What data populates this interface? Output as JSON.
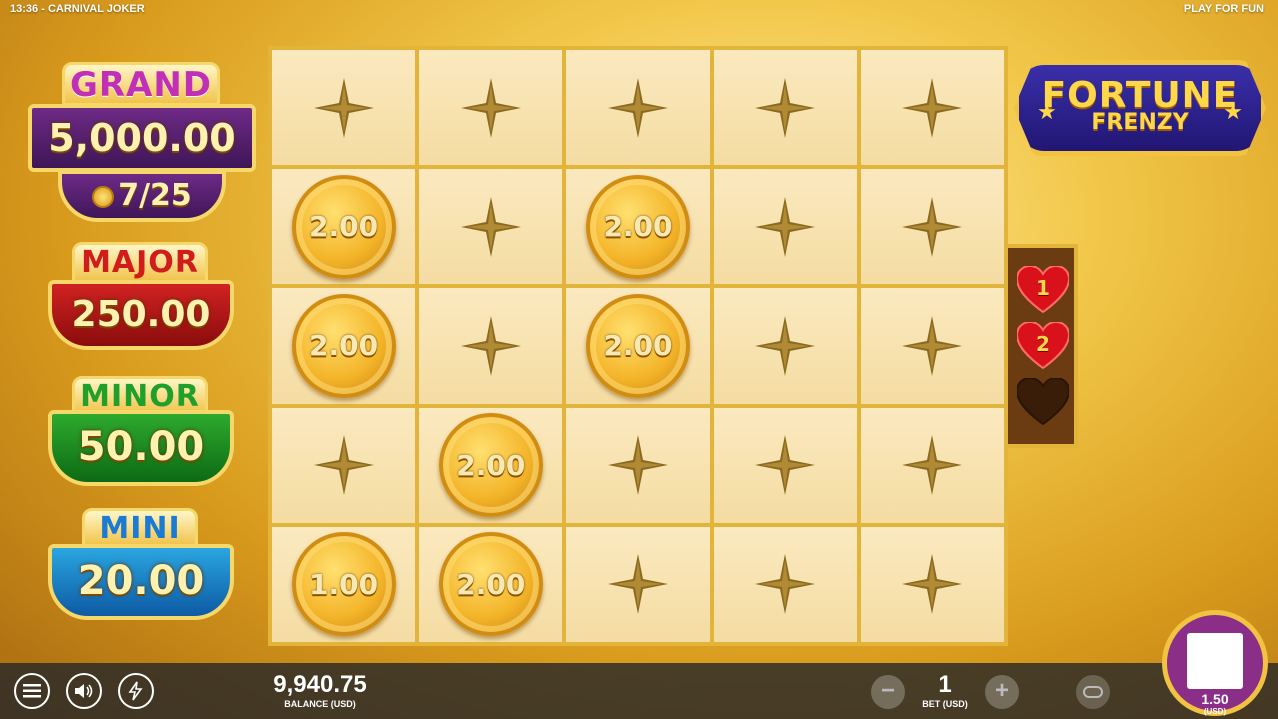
{
  "header": {
    "time": "13:36",
    "separator": "-",
    "game_title": "CARNIVAL JOKER",
    "mode": "PLAY FOR FUN"
  },
  "jackpots": {
    "grand": {
      "label": "GRAND",
      "value": "5,000.00",
      "progress": "7/25"
    },
    "major": {
      "label": "MAJOR",
      "value": "250.00"
    },
    "minor": {
      "label": "MINOR",
      "value": "50.00"
    },
    "mini": {
      "label": "MINI",
      "value": "20.00"
    }
  },
  "logo": {
    "line1": "FORTUNE",
    "line2": "FRENZY"
  },
  "grid": {
    "rows": [
      [
        "star",
        "star",
        "star",
        "star",
        "star"
      ],
      [
        "2.00",
        "star",
        "2.00",
        "star",
        "star"
      ],
      [
        "2.00",
        "star",
        "2.00",
        "star",
        "star"
      ],
      [
        "star",
        "2.00",
        "star",
        "star",
        "star"
      ],
      [
        "1.00",
        "2.00",
        "star",
        "star",
        "star"
      ]
    ]
  },
  "lives": [
    {
      "label": "1",
      "active": true,
      "color": "#d9111a"
    },
    {
      "label": "2",
      "active": true,
      "color": "#d9111a"
    },
    {
      "label": "",
      "active": false,
      "color": "#3a1d08"
    }
  ],
  "footer": {
    "balance_value": "9,940.75",
    "balance_label": "BALANCE (USD)",
    "bet_value": "1",
    "bet_label": "BET (USD)",
    "minus": "−",
    "plus": "+",
    "spin_amount": "1.50",
    "spin_currency": "(USD)"
  },
  "colors": {
    "gold": "#e3b43a",
    "cell": "#f7e2ad",
    "coin": "#f4b52a",
    "spin": "#8a2e88"
  }
}
